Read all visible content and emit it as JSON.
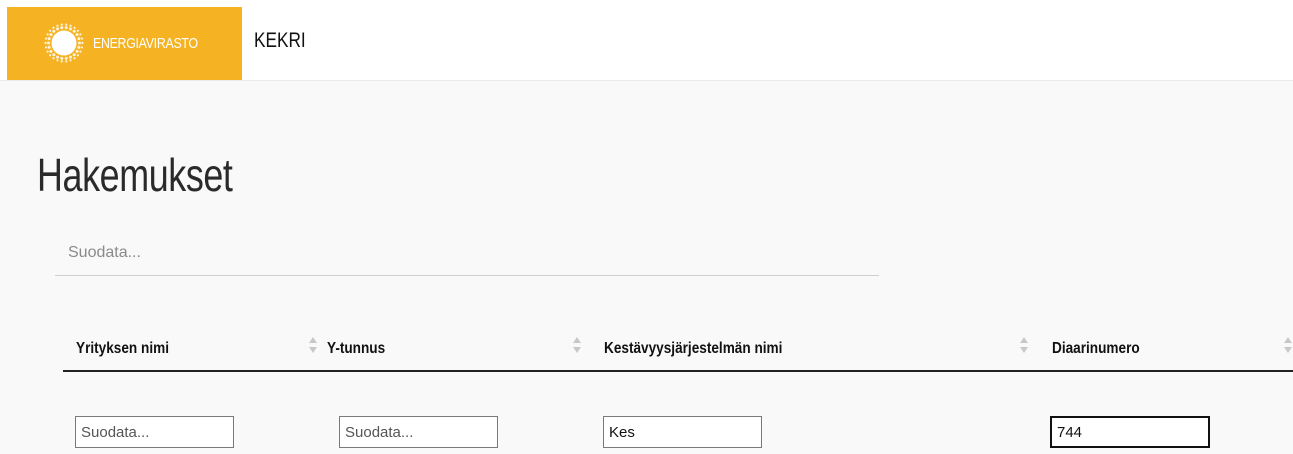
{
  "header": {
    "brand_name": "ENERGIAVIRASTO",
    "app_title": "KEKRI",
    "brand_color": "#f5b324"
  },
  "page": {
    "title": "Hakemukset",
    "global_filter_placeholder": "Suodata..."
  },
  "table": {
    "columns": [
      {
        "label": "Yrityksen nimi",
        "filter_value": "",
        "filter_placeholder": "Suodata..."
      },
      {
        "label": "Y-tunnus",
        "filter_value": "",
        "filter_placeholder": "Suodata..."
      },
      {
        "label": "Kestävyysjärjestelmän nimi",
        "filter_value": "Kes",
        "filter_placeholder": "Suodata..."
      },
      {
        "label": "Diaarinumero",
        "filter_value": "744",
        "filter_placeholder": "Suodata..."
      }
    ]
  },
  "icons": {
    "logo": "energiavirasto-logo-icon",
    "sort": "sort-icon"
  }
}
